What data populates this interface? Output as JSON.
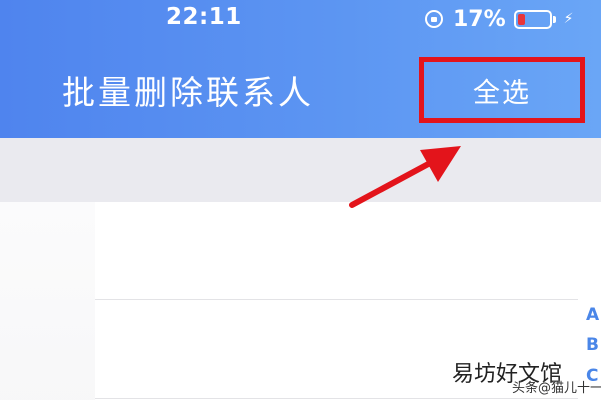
{
  "status_bar": {
    "time": "22:11",
    "battery_percent": "17%",
    "battery_level": 0.17,
    "icons": [
      "rotation-lock-icon",
      "battery-icon",
      "charging-bolt-icon"
    ]
  },
  "nav_bar": {
    "title": "批量删除联系人",
    "select_all_label": "全选"
  },
  "index_bar": {
    "letters": [
      "A",
      "B",
      "C"
    ]
  },
  "annotation": {
    "highlight_color": "#e3141b",
    "arrow_icon": "red-arrow-icon"
  },
  "watermark": {
    "text": "易坊好文馆",
    "sub_text": "头条@猫儿十一"
  },
  "colors": {
    "header_start": "#4f84ee",
    "header_end": "#6aa6f6",
    "index_blue": "#4a86e8",
    "band_gray": "#eaeaef"
  }
}
